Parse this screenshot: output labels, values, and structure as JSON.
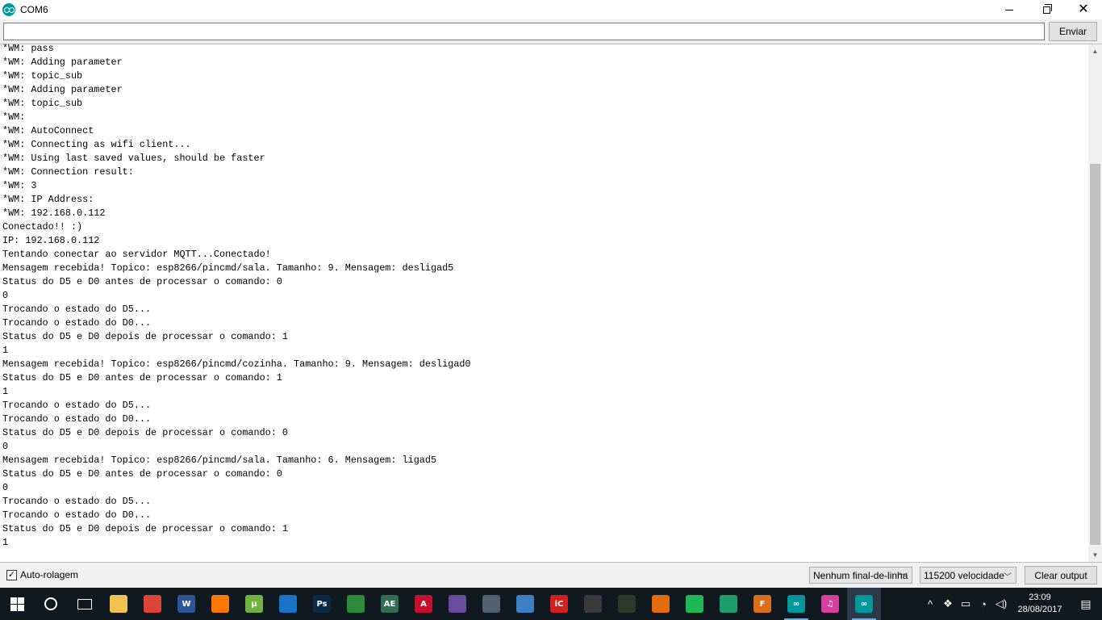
{
  "window": {
    "title": "COM6",
    "controls": {
      "minimize": "—",
      "restore": "❐",
      "close": "✕"
    }
  },
  "sendbar": {
    "input_value": "",
    "send_label": "Enviar"
  },
  "output": {
    "lines": [
      "*WM: pass",
      "*WM: Adding parameter",
      "*WM: topic_sub",
      "*WM: Adding parameter",
      "*WM: topic_sub",
      "*WM:",
      "*WM: AutoConnect",
      "*WM: Connecting as wifi client...",
      "*WM: Using last saved values, should be faster",
      "*WM: Connection result:",
      "*WM: 3",
      "*WM: IP Address:",
      "*WM: 192.168.0.112",
      "Conectado!! :)",
      "IP: 192.168.0.112",
      "Tentando conectar ao servidor MQTT...Conectado!",
      "Mensagem recebida! Topico: esp8266/pincmd/sala. Tamanho: 9. Mensagem: desligad5",
      "Status do D5 e D0 antes de processar o comando: 0",
      "0",
      "Trocando o estado do D5...",
      "Trocando o estado do D0...",
      "Status do D5 e D0 depois de processar o comando: 1",
      "1",
      "Mensagem recebida! Topico: esp8266/pincmd/cozinha. Tamanho: 9. Mensagem: desligad0",
      "Status do D5 e D0 antes de processar o comando: 1",
      "1",
      "Trocando o estado do D5...",
      "Trocando o estado do D0...",
      "Status do D5 e D0 depois de processar o comando: 0",
      "0",
      "Mensagem recebida! Topico: esp8266/pincmd/sala. Tamanho: 6. Mensagem: ligad5",
      "Status do D5 e D0 antes de processar o comando: 0",
      "0",
      "Trocando o estado do D5...",
      "Trocando o estado do D0...",
      "Status do D5 e D0 depois de processar o comando: 1",
      "1"
    ]
  },
  "bottombar": {
    "autoscroll_label": "Auto-rolagem",
    "autoscroll_checked": true,
    "line_ending": "Nenhum final-de-linha",
    "baud": "115200 velocidade",
    "clear_label": "Clear output"
  },
  "taskbar": {
    "apps": [
      {
        "name": "file-explorer",
        "letter": "",
        "color": "#f2c14e"
      },
      {
        "name": "chrome",
        "letter": "",
        "color": "#db4437"
      },
      {
        "name": "word",
        "letter": "W",
        "color": "#2b579a"
      },
      {
        "name": "avast",
        "letter": "",
        "color": "#ff7800"
      },
      {
        "name": "utorrent",
        "letter": "µ",
        "color": "#6fb43f"
      },
      {
        "name": "app-blue",
        "letter": "",
        "color": "#1a73c9"
      },
      {
        "name": "photoshop",
        "letter": "Ps",
        "color": "#0b2a4a"
      },
      {
        "name": "sketchup",
        "letter": "",
        "color": "#2d8a3a"
      },
      {
        "name": "app-ae",
        "letter": "AE",
        "color": "#2f6f4f"
      },
      {
        "name": "autocad",
        "letter": "A",
        "color": "#c8102e"
      },
      {
        "name": "app-grid",
        "letter": "",
        "color": "#6a4c9c"
      },
      {
        "name": "app-star",
        "letter": "",
        "color": "#506070"
      },
      {
        "name": "app-globe",
        "letter": "",
        "color": "#3c7fc4"
      },
      {
        "name": "app-ic",
        "letter": "iC",
        "color": "#d21f1f"
      },
      {
        "name": "app-x",
        "letter": "",
        "color": "#3a3a3a"
      },
      {
        "name": "app-terminal",
        "letter": "",
        "color": "#2c3a2c"
      },
      {
        "name": "matlab",
        "letter": "",
        "color": "#e46c0a"
      },
      {
        "name": "spotify",
        "letter": "",
        "color": "#1db954"
      },
      {
        "name": "app-bars",
        "letter": "",
        "color": "#1c9d6b"
      },
      {
        "name": "fritzing",
        "letter": "F",
        "color": "#d96d1a"
      },
      {
        "name": "arduino",
        "letter": "∞",
        "color": "#00979c"
      },
      {
        "name": "itunes",
        "letter": "♫",
        "color": "#d6409f"
      },
      {
        "name": "arduino-serial",
        "letter": "∞",
        "color": "#00979c"
      }
    ],
    "time": "23:09",
    "date": "28/08/2017"
  }
}
